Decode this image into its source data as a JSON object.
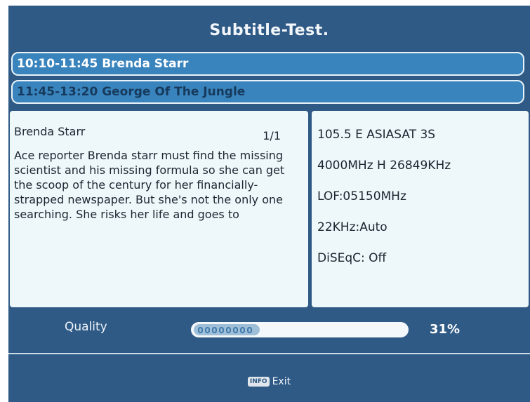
{
  "title": "Subtitle-Test.",
  "programs": [
    {
      "label": "10:10-11:45  Brenda Starr"
    },
    {
      "label": "11:45-13:20  George Of The Jungle"
    }
  ],
  "description": {
    "title": "Brenda Starr",
    "page": "1/1",
    "text": "Ace reporter Brenda starr must find the missing scientist and his missing formula so she can get the scoop of the century for her financially-strapped newspaper. But she's not the only one searching. She risks her life and goes to"
  },
  "info": {
    "satellite": "105.5 E  ASIASAT 3S",
    "transponder": "4000MHz H 26849KHz",
    "lof": "LOF:05150MHz",
    "tone": "22KHz:Auto",
    "diseqc": "DiSEqC: Off"
  },
  "quality": {
    "label": "Quality",
    "percent_text": "31%",
    "level": 0.31
  },
  "footer": {
    "key_label": "INFO",
    "exit_label": "Exit"
  }
}
